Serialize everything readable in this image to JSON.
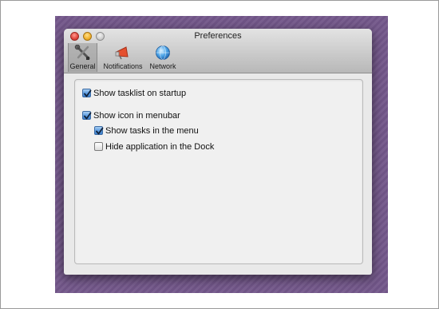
{
  "window": {
    "title": "Preferences"
  },
  "toolbar": {
    "tabs": [
      {
        "label": "General",
        "icon": "tools-icon",
        "selected": true
      },
      {
        "label": "Notifications",
        "icon": "megaphone-icon",
        "selected": false
      },
      {
        "label": "Network",
        "icon": "globe-icon",
        "selected": false
      }
    ]
  },
  "options": {
    "show_tasklist": {
      "label": "Show tasklist on startup",
      "checked": true
    },
    "show_icon_menubar": {
      "label": "Show icon in menubar",
      "checked": true
    },
    "show_tasks_menu": {
      "label": "Show tasks in the menu",
      "checked": true
    },
    "hide_dock": {
      "label": "Hide application in the Dock",
      "checked": false
    }
  },
  "colors": {
    "desktop": "#73578a",
    "checkbox_checked": "#5a9ae0"
  }
}
